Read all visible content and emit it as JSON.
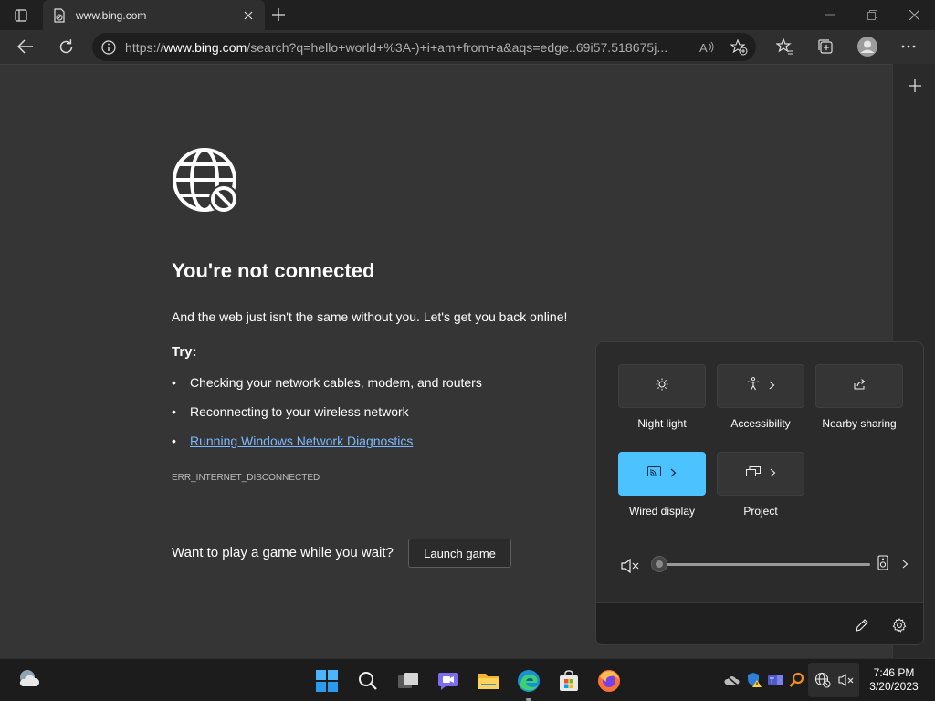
{
  "browser": {
    "tab_title": "www.bing.com",
    "url_prefix": "https://",
    "url_host": "www.bing.com",
    "url_path": "/search?q=hello+world+%3A-)+i+am+from+a&aqs=edge..69i57.518675j...",
    "icons": {
      "tab_actions": "tab-actions-icon",
      "favicon": "offline-page-icon",
      "close_tab": "close-icon",
      "new_tab": "plus-icon",
      "minimize": "minimize-icon",
      "restore": "restore-icon",
      "close_window": "close-icon",
      "back": "back-arrow-icon",
      "refresh": "refresh-icon",
      "info": "info-icon",
      "read_aloud": "read-aloud-icon",
      "add_favorite": "star-plus-icon",
      "favorites": "favorites-icon",
      "collections": "collections-icon",
      "profile": "profile-avatar-icon",
      "menu": "more-icon",
      "sidebar_add": "plus-icon"
    }
  },
  "error_page": {
    "title": "You're not connected",
    "subtitle": "And the web just isn't the same without you. Let's get you back online!",
    "try_label": "Try:",
    "suggestions": [
      "Checking your network cables, modem, and routers",
      "Reconnecting to your wireless network",
      "Running Windows Network Diagnostics"
    ],
    "error_code": "ERR_INTERNET_DISCONNECTED",
    "game_prompt": "Want to play a game while you wait?",
    "game_button": "Launch game",
    "icon": "globe-blocked-icon"
  },
  "quick_settings": {
    "tiles": [
      {
        "label": "Night light",
        "icon": "night-light-icon",
        "has_chevron": false,
        "active": false
      },
      {
        "label": "Accessibility",
        "icon": "accessibility-icon",
        "has_chevron": true,
        "active": false
      },
      {
        "label": "Nearby sharing",
        "icon": "share-icon",
        "has_chevron": false,
        "active": false
      },
      {
        "label": "Wired display",
        "icon": "cast-icon",
        "has_chevron": true,
        "active": true
      },
      {
        "label": "Project",
        "icon": "project-icon",
        "has_chevron": true,
        "active": false
      }
    ],
    "volume_level": 0,
    "volume_muted": true,
    "footer_icons": [
      "edit-icon",
      "settings-icon"
    ]
  },
  "taskbar": {
    "time": "7:46 PM",
    "date": "3/20/2023",
    "apps": [
      "weather-icon",
      "start-icon",
      "search-icon",
      "task-view-icon",
      "chat-icon",
      "file-explorer-icon",
      "edge-icon",
      "store-icon",
      "firefox-icon"
    ],
    "tray": [
      "onedrive-offline-icon",
      "defender-warning-icon",
      "teams-icon",
      "search-app-icon",
      "network-offline-icon",
      "volume-muted-icon"
    ]
  },
  "colors": {
    "accent": "#4cc2ff",
    "link": "#7cb7ff",
    "page_bg": "#353535",
    "chrome_bg": "#202020"
  }
}
